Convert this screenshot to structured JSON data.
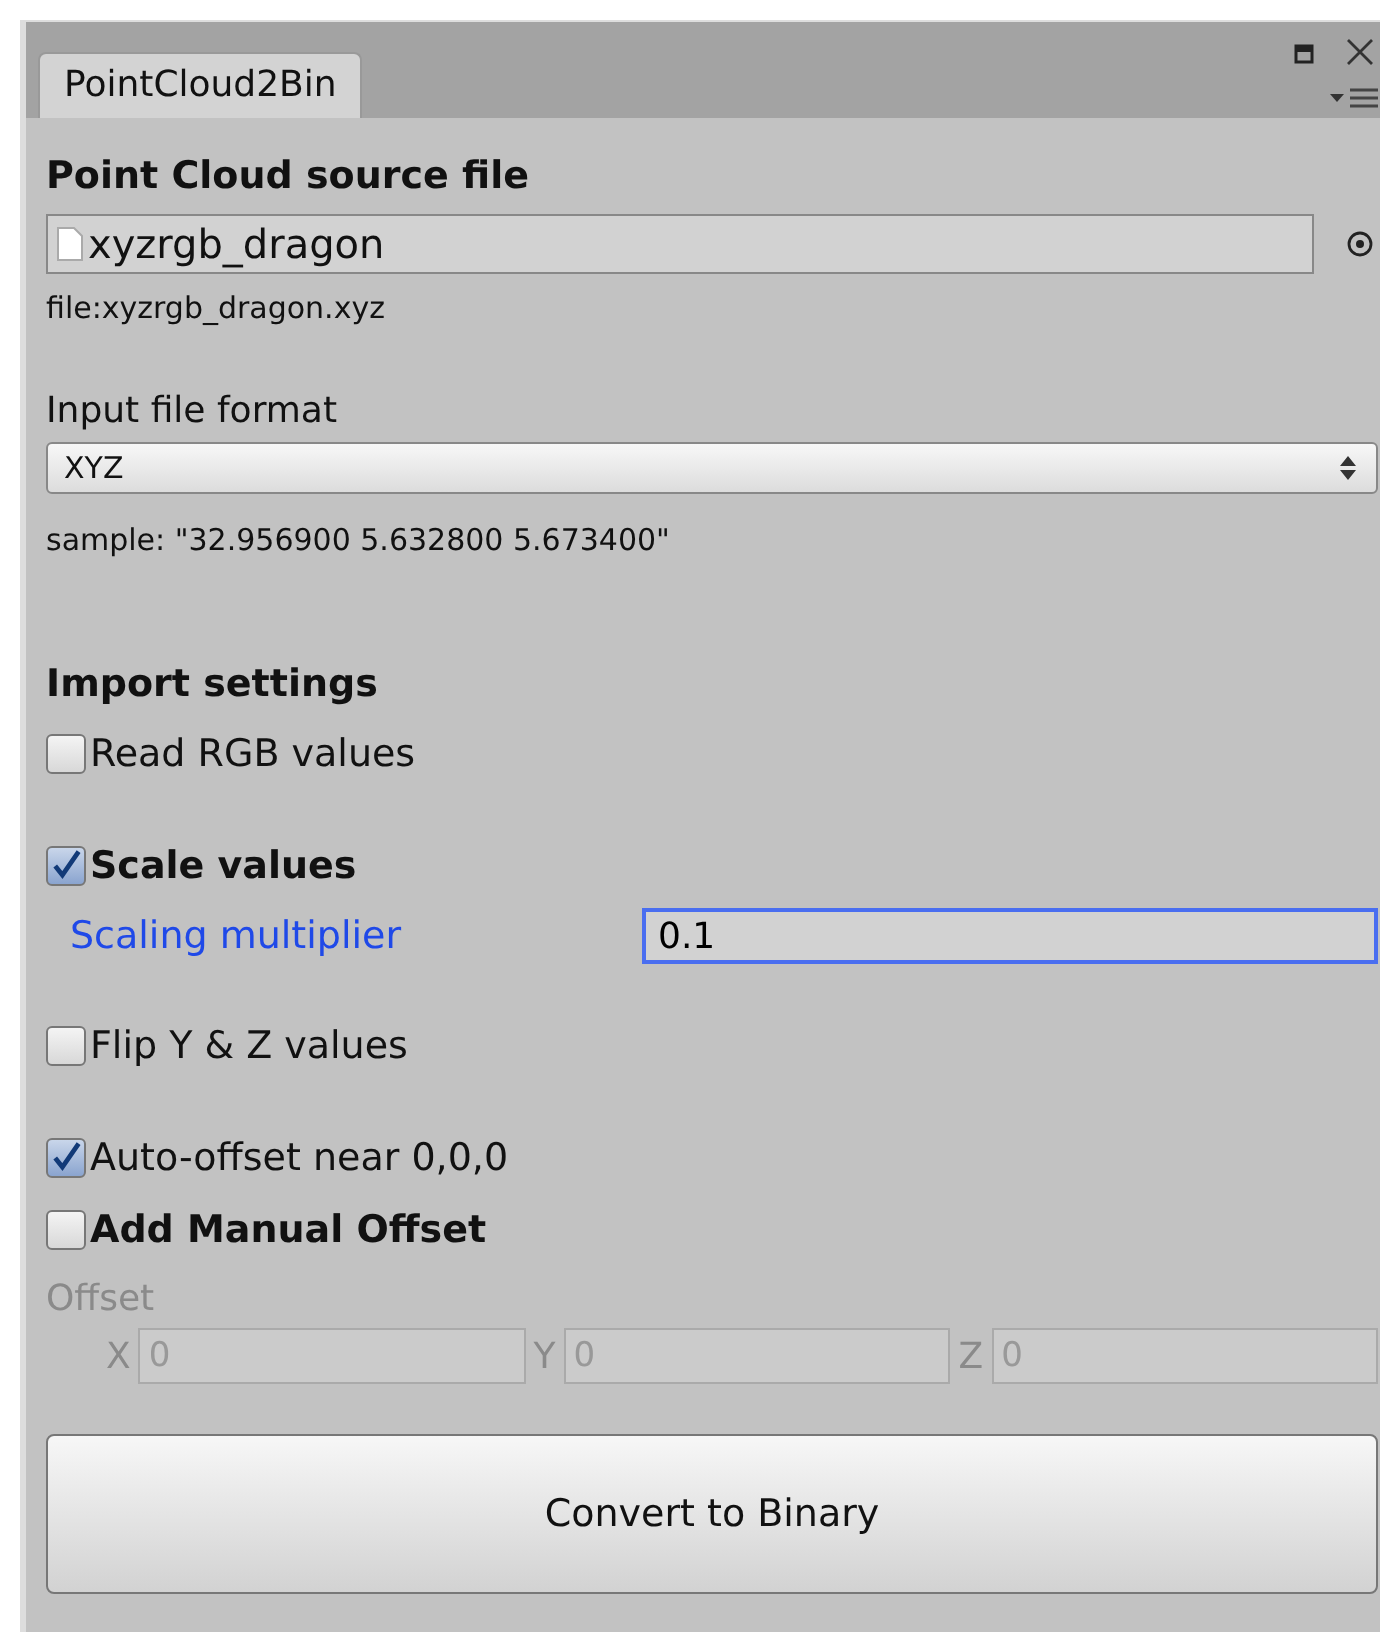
{
  "window": {
    "tab": "PointCloud2Bin"
  },
  "items": [
    {
      "kind": "heading",
      "text": "Point Cloud source file"
    },
    {
      "kind": "object",
      "value": "xyzrgb_dragon"
    },
    {
      "kind": "note",
      "text": "file:xyzrgb_dragon.xyz"
    },
    {
      "kind": "gap"
    },
    {
      "kind": "label",
      "text": "Input file format"
    },
    {
      "kind": "dropdown",
      "value": "XYZ"
    },
    {
      "kind": "note",
      "text": "sample: \"32.956900 5.632800 5.673400\""
    },
    {
      "kind": "gap"
    },
    {
      "kind": "gap"
    },
    {
      "kind": "heading",
      "text": "Import settings"
    },
    {
      "kind": "checkbox",
      "label": "Read RGB values",
      "checked": false,
      "bold": false
    },
    {
      "kind": "gap"
    },
    {
      "kind": "checkbox",
      "label": "Scale values",
      "checked": true,
      "bold": true
    },
    {
      "kind": "float",
      "label": "Scaling multiplier",
      "value": "0.1",
      "focused": true
    },
    {
      "kind": "gap"
    },
    {
      "kind": "checkbox",
      "label": "Flip Y & Z values",
      "checked": false,
      "bold": false
    },
    {
      "kind": "gap"
    },
    {
      "kind": "checkbox",
      "label": "Auto-offset near 0,0,0",
      "checked": true,
      "bold": false
    },
    {
      "kind": "checkbox",
      "label": "Add Manual Offset",
      "checked": false,
      "bold": true
    },
    {
      "kind": "vector",
      "label": "Offset",
      "disabled": true,
      "axes": [
        {
          "name": "X",
          "value": "0"
        },
        {
          "name": "Y",
          "value": "0"
        },
        {
          "name": "Z",
          "value": "0"
        }
      ]
    },
    {
      "kind": "button",
      "text": "Convert to Binary"
    }
  ]
}
